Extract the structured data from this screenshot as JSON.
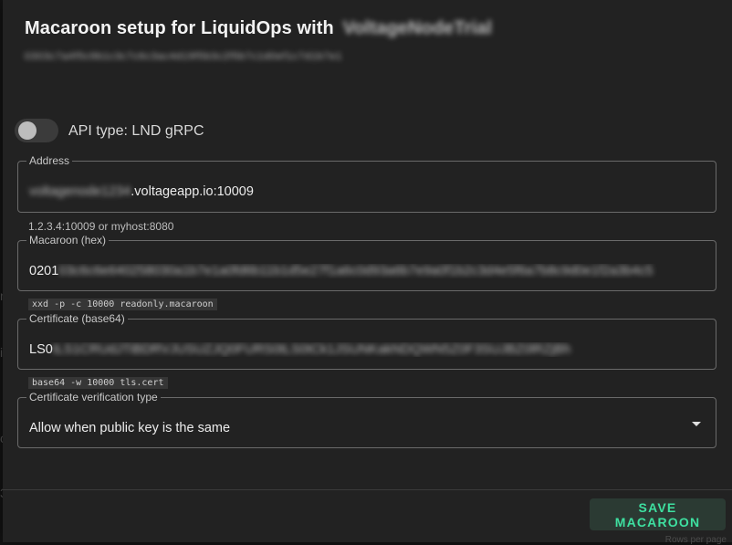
{
  "dialog": {
    "title_prefix": "Macaroon setup for LiquidOps with",
    "title_blurred": "VoltageNodeTrial",
    "subtitle_blurred": "0303c7a4f5c9b1c3c7c6c3ac4d19f5b3c2f5b7c1d0ef1c7d1b7e1"
  },
  "api_type": {
    "label": "API type: LND gRPC",
    "checked": false
  },
  "address": {
    "label": "Address",
    "value_blurred": "voltagenode1234",
    "value": ".voltageapp.io:10009",
    "helper": "1.2.3.4:10009 or myhost:8080"
  },
  "macaroon": {
    "label": "Macaroon (hex)",
    "value": "0201",
    "value_blurred": "03c6c6e640258030a1b7e1a0fd6b11b1d5e27f1a6c0d93a6b7e9a0f1b2c3d4e5f6a7b8c9d0e1f2a3b4c5",
    "helper_code": "xxd -p -c 10000 readonly.macaroon"
  },
  "certificate": {
    "label": "Certificate (base64)",
    "value": "LS0",
    "value_blurred": "tLS1CRUdJTiBDRVJUSUZJQ0FURS0tLS0tCk1JSUNKakNDQWN5Z0F3SUJBZ0lRZjBh",
    "helper_code": "base64 -w 10000 tls.cert"
  },
  "verification": {
    "label": "Certificate verification type",
    "value": "Allow when public key is the same"
  },
  "actions": {
    "save_label": "SAVE MACAROON"
  },
  "background": {
    "glyphs": [
      "n",
      "i",
      "c",
      "3"
    ],
    "footer_fragment": "Rows per page"
  }
}
